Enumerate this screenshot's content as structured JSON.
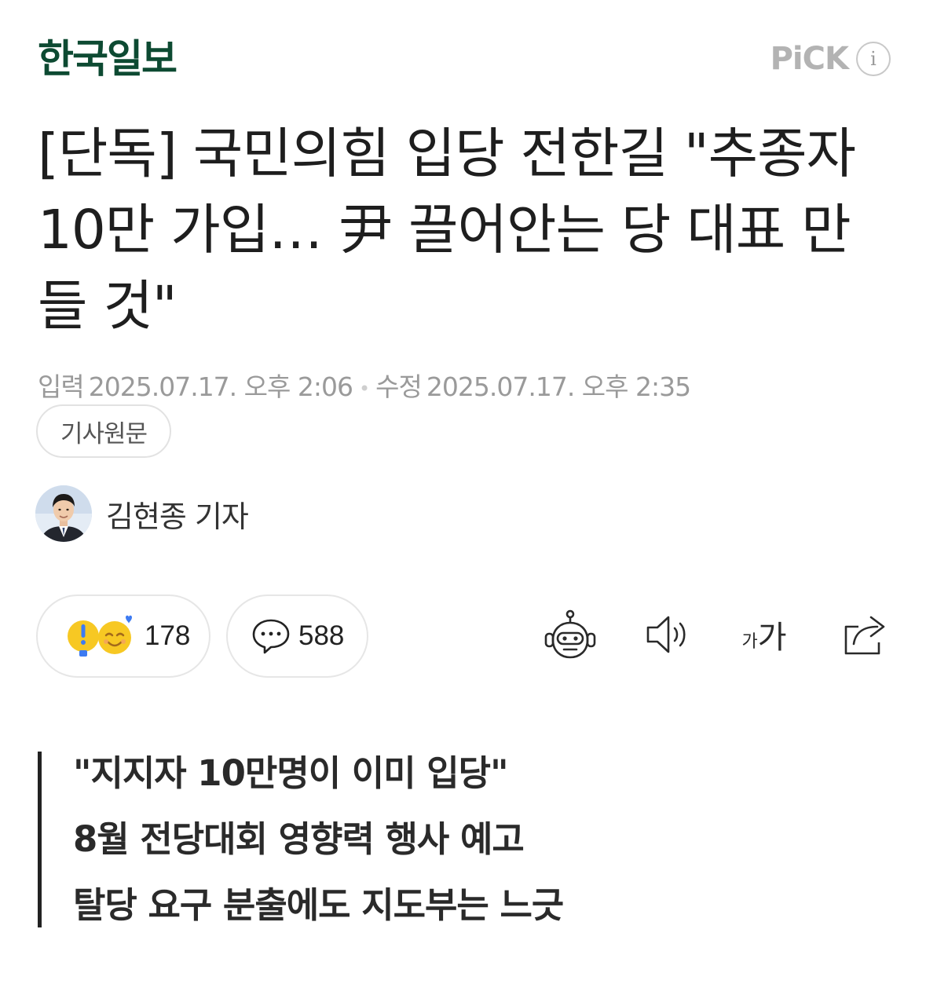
{
  "header": {
    "press_name": "한국일보",
    "pick_label": "PiCK",
    "info_symbol": "i"
  },
  "article": {
    "headline": "[단독] 국민의힘 입당 전한길 \"추종자 10만 가입… 尹 끌어안는 당 대표 만들 것\"",
    "meta": {
      "published_label": "입력",
      "published": "2025.07.17. 오후 2:06",
      "separator": "•",
      "modified_label": "수정",
      "modified": "2025.07.17. 오후 2:35"
    },
    "original_button": "기사원문",
    "reporter": "김현종 기자"
  },
  "actions": {
    "reactions_count": "178",
    "comments_count": "588",
    "tool_icons": [
      "robot-summary-icon",
      "speaker-icon",
      "font-size-icon",
      "share-icon"
    ],
    "font_size_small": "가",
    "font_size_large": "가"
  },
  "summary": {
    "lines": [
      "\"지지자 10만명이 이미 입당\"",
      "8월 전당대회 영향력 행사 예고",
      "탈당 요구 분출에도 지도부는 느긋"
    ]
  },
  "colors": {
    "logo": "#0d4a32",
    "muted": "#9a9a9a",
    "reaction_yellow": "#f7c823",
    "reaction_blue": "#3d7bf2"
  }
}
